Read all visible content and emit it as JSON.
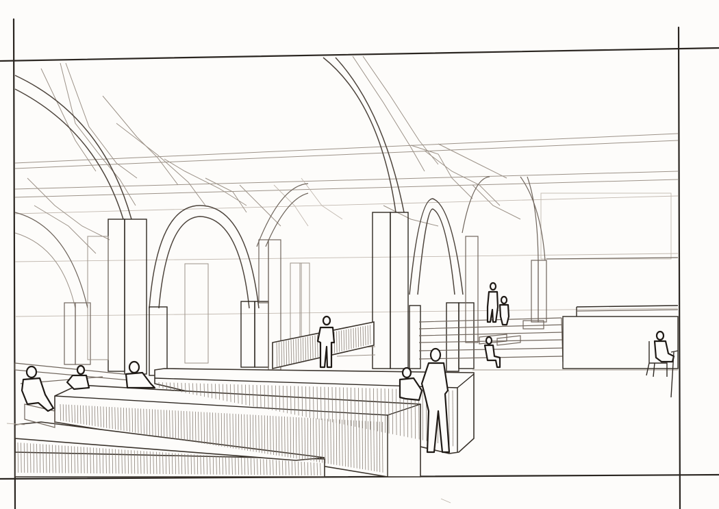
{
  "drawing": {
    "ink_color": "#2a2520",
    "paper_color": "#fdfcfa",
    "secondary_line_color": "#9c9288"
  }
}
